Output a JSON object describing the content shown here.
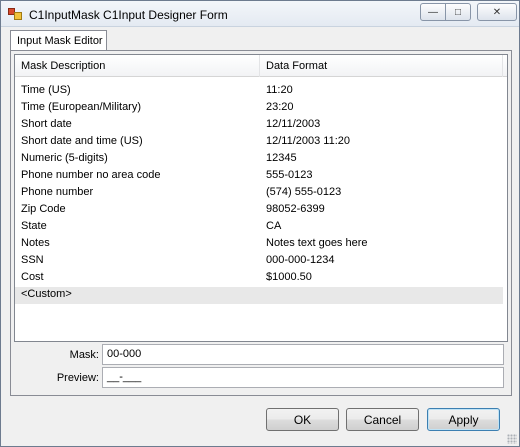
{
  "window": {
    "title": "C1InputMask C1Input Designer Form",
    "minimize_glyph": "—",
    "maximize_glyph": "□",
    "close_glyph": "✕"
  },
  "tabs": [
    {
      "label": "Input Mask Editor",
      "selected": true
    }
  ],
  "grid": {
    "columns": [
      "Mask Description",
      "Data Format"
    ],
    "rows": [
      {
        "description": "Time (US)",
        "format": "11:20"
      },
      {
        "description": "Time (European/Military)",
        "format": "23:20"
      },
      {
        "description": "Short date",
        "format": "12/11/2003"
      },
      {
        "description": "Short date and time (US)",
        "format": "12/11/2003 11:20"
      },
      {
        "description": "Numeric (5-digits)",
        "format": "12345"
      },
      {
        "description": "Phone number no area code",
        "format": "555-0123"
      },
      {
        "description": "Phone number",
        "format": "(574) 555-0123"
      },
      {
        "description": "Zip Code",
        "format": "98052-6399"
      },
      {
        "description": "State",
        "format": "CA"
      },
      {
        "description": "Notes",
        "format": "Notes text goes here"
      },
      {
        "description": "SSN",
        "format": "000-000-1234"
      },
      {
        "description": "Cost",
        "format": "$1000.50"
      },
      {
        "description": "<Custom>",
        "format": ""
      }
    ]
  },
  "mask": {
    "label": "Mask:",
    "value": "00-000"
  },
  "preview": {
    "label": "Preview:",
    "value": "__-___"
  },
  "buttons": {
    "ok": "OK",
    "cancel": "Cancel",
    "apply": "Apply"
  }
}
